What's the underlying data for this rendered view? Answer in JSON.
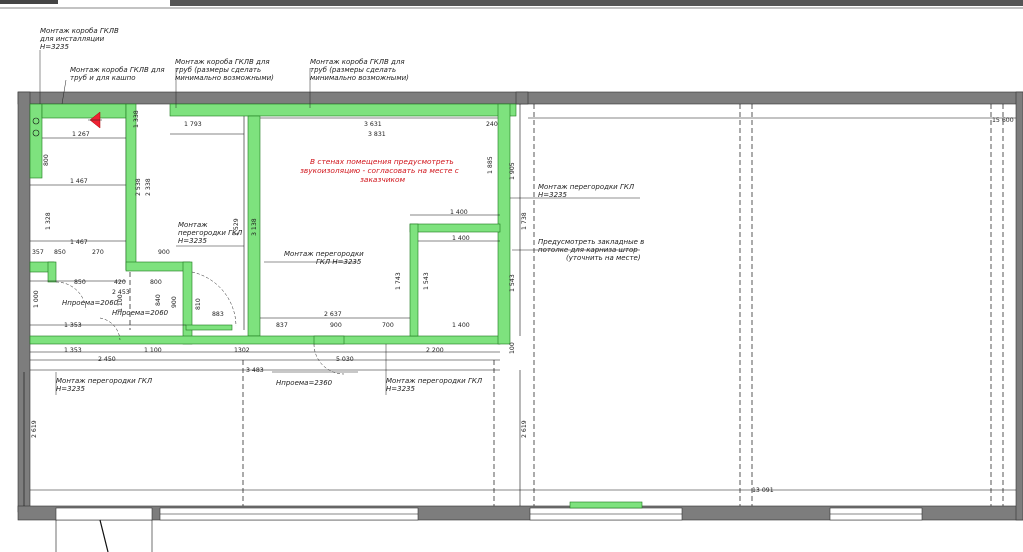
{
  "annotations": {
    "box_install_1": "Монтаж короба ГКЛВ",
    "box_install_2": "для инсталляции",
    "box_install_3": "H=3235",
    "box_pipes_drain_1": "Монтаж короба ГКЛВ для",
    "box_pipes_drain_2": "труб и для кашпо",
    "box_pipes_a_1": "Монтаж короба ГКЛВ для",
    "box_pipes_a_2": "труб (размеры сделать",
    "box_pipes_a_3": "минимально возможными)",
    "box_pipes_b_1": "Монтаж короба ГКЛВ для",
    "box_pipes_b_2": "труб (размеры сделать",
    "box_pipes_b_3": "минимально возможными)",
    "partition_right_1": "Монтаж перегородки ГКЛ",
    "partition_right_2": "H=3235",
    "partition_mid_1": "Монтаж",
    "partition_mid_2": "перегородки ГКЛ",
    "partition_mid_3": "H=3235",
    "partition_center_1": "Монтаж перегородки",
    "partition_center_2": "ГКЛ H=3235",
    "partition_bottom_left_1": "Монтаж перегородки ГКЛ",
    "partition_bottom_left_2": "H=3235",
    "partition_bottom_mid_1": "Монтаж перегородки ГКЛ",
    "partition_bottom_mid_2": "H=3235",
    "cornice_1": "Предусмотреть закладные в",
    "cornice_2": "потолке для карниза штор",
    "cornice_3": "(уточнить на месте)",
    "opening_2060_a": "Hпроема=2060",
    "opening_2060_b": "Hпроема=2060",
    "opening_2360": "Hпроема=2360"
  },
  "note": {
    "line1": "В стенах помещения предусмотреть",
    "line2": "звукоизоляцию - согласовать на месте с",
    "line3": "заказчиком"
  },
  "dimensions": {
    "d1267": "1 267",
    "d1793": "1 793",
    "d3631": "3 631",
    "d3831": "3 831",
    "d1467a": "1 467",
    "d1467b": "1 467",
    "d1328": "1 328",
    "d850a": "850",
    "d850b": "850",
    "d270": "270",
    "d357": "357",
    "d420": "420",
    "d800a": "800",
    "d900a": "900",
    "d2453": "2 453",
    "d1353a": "1 353",
    "d1353b": "1 353",
    "d1100a": "1 100",
    "d1100b": "1 100",
    "d2450": "2 450",
    "d883": "883",
    "d837": "837",
    "d2637": "2 637",
    "d900b": "900",
    "d700": "700",
    "d1400a": "1 400",
    "d1400b": "1 400",
    "d1400c": "1 400",
    "d2200": "2 200",
    "d5030": "5 030",
    "d3483": "3 483",
    "d1302": "1302",
    "d2619a": "2 619",
    "d2619b": "2 619",
    "d2338": "2 338",
    "d2538": "2 538",
    "d3138": "3 138",
    "d1338": "1 338",
    "d1738": "1 738",
    "d1885": "1 885",
    "d1905": "1 905",
    "d1743": "1 743",
    "d1543a": "1 543",
    "d1543b": "1 543",
    "d800b": "800",
    "d900c": "900",
    "d810": "810",
    "d840": "840",
    "d1000": "1 000",
    "d100": "100",
    "d240": "240",
    "d15600": "15 600",
    "d13091": "13 091",
    "d1529": "1 529"
  }
}
